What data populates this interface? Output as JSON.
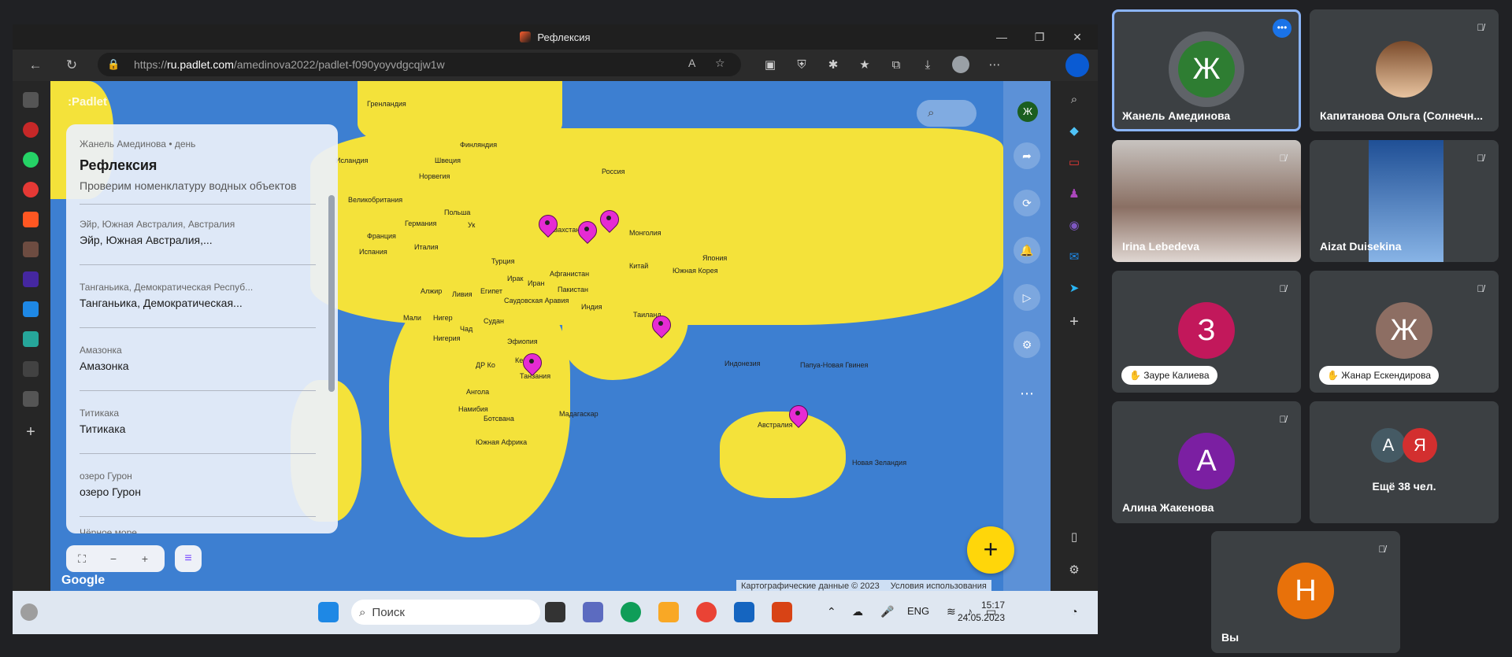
{
  "browser": {
    "title": "Рефлексия",
    "url_prefix": "https://",
    "url_host": "ru.padlet.com",
    "url_path": "/amedinova2022/padlet-f090yoyvdgcqjw1w"
  },
  "padlet": {
    "logo": ":Padlet",
    "author": "Жанель Амединова",
    "time": "• день",
    "title": "Рефлексия",
    "subtitle": "Проверим номенклатуру водных объектов",
    "posts": [
      {
        "small": "Эйр, Южная Австралия, Австралия",
        "big": "Эйр, Южная Австралия,..."
      },
      {
        "small": "Танганьика, Демократическая Респуб...",
        "big": "Танганьика, Демократическая..."
      },
      {
        "small": "Амазонка",
        "big": "Амазонка"
      },
      {
        "small": "Титикака",
        "big": "Титикака"
      },
      {
        "small": "озеро Гурон",
        "big": "озеро Гурон"
      },
      {
        "small": "Чёрное море",
        "big": ""
      }
    ],
    "user_initial": "Ж",
    "google": "Google",
    "attribution": "Картографические данные © 2023",
    "terms": "Условия использования"
  },
  "map_labels": [
    "Гренландия",
    "Исландия",
    "Финляндия",
    "Швеция",
    "Норвегия",
    "Россия",
    "Великобритания",
    "Германия",
    "Польша",
    "Франция",
    "Испания",
    "Италия",
    "Ук",
    "Казахстан",
    "Монголия",
    "Турция",
    "Ирак",
    "Иран",
    "Афганистан",
    "Китай",
    "Япония",
    "Южная Корея",
    "Алжир",
    "Ливия",
    "Египет",
    "Саудовская Аравия",
    "Пакистан",
    "Индия",
    "Таиланд",
    "Мали",
    "Нигер",
    "Чад",
    "Судан",
    "Эфиопия",
    "Нигерия",
    "ДР Ко",
    "Кения",
    "Танзания",
    "Ангола",
    "Намибия",
    "Ботсвана",
    "Мадагаскар",
    "Южная Африка",
    "Индонезия",
    "Папуа-Новая Гвинея",
    "Австралия",
    "Новая Зеландия"
  ],
  "taskbar": {
    "search": "Поиск",
    "lang": "ENG",
    "time": "15:17",
    "date": "24.05.2023"
  },
  "meet": {
    "tiles": [
      {
        "name": "Жанель Амединова",
        "initial": "Ж",
        "color": "#2e7d32"
      },
      {
        "name": "Капитанова Ольга (Солнечн...",
        "initial": "",
        "color": ""
      },
      {
        "name": "Irina Lebedeva",
        "initial": "",
        "color": ""
      },
      {
        "name": "Aizat Duisekina",
        "initial": "",
        "color": ""
      },
      {
        "name": "Зауре Калиева",
        "initial": "З",
        "color": "#c2185b"
      },
      {
        "name": "Жанар Ескендирова",
        "initial": "Ж",
        "color": "#8d6e63"
      },
      {
        "name": "Алина Жакенова",
        "initial": "А",
        "color": "#7b1fa2"
      },
      {
        "name": "Ещё 38 чел.",
        "initial": "",
        "color": ""
      },
      {
        "name": "Вы",
        "initial": "Н",
        "color": "#e8710a"
      }
    ],
    "more_initials": [
      "А",
      "Я"
    ]
  },
  "colors": {
    "ocean": "#3d7fd1",
    "land": "#f4e23a",
    "pin": "#e62bd3",
    "fab": "#ffd60a",
    "accent": "#1a73e8"
  }
}
